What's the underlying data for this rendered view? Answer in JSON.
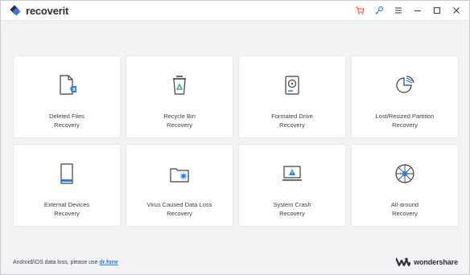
{
  "app": {
    "logo_text_a": "recover",
    "logo_text_b": "it"
  },
  "titlebar": {
    "icons": [
      "cart-icon",
      "key-icon",
      "menu-icon",
      "minimize-icon",
      "maximize-icon",
      "close-icon"
    ],
    "accent_color": "#e84a3a",
    "key_color": "#2f7ae5"
  },
  "cards": [
    {
      "line1": "Deleted Files",
      "line2": "Recovery",
      "icon": "deleted-file-icon"
    },
    {
      "line1": "Recycle Bin",
      "line2": "Recovery",
      "icon": "recycle-bin-icon"
    },
    {
      "line1": "Formated Drive",
      "line2": "Recovery",
      "icon": "formatted-drive-icon"
    },
    {
      "line1": "Lost/Resized Partition",
      "line2": "Recovery",
      "icon": "partition-icon"
    },
    {
      "line1": "External Devices",
      "line2": "Recovery",
      "icon": "external-device-icon"
    },
    {
      "line1": "Virus Caused Data Loss",
      "line2": "Recovery",
      "icon": "virus-folder-icon"
    },
    {
      "line1": "System Crash",
      "line2": "Recovery",
      "icon": "system-crash-icon"
    },
    {
      "line1": "All-around",
      "line2": "Recovery",
      "icon": "all-around-icon"
    }
  ],
  "footer": {
    "text": "Android/iOS data loss, please use ",
    "link": "dr.fone"
  },
  "brand": {
    "name": "wondershare"
  }
}
